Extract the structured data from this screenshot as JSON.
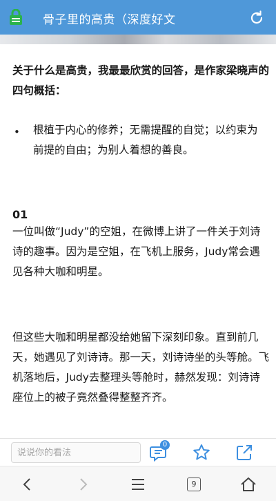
{
  "titlebar": {
    "title": "骨子里的高贵（深度好文"
  },
  "article": {
    "intro": "关于什么是高贵，我最最欣赏的回答，是作家梁晓声的四句概括：",
    "bullet_marker": "•",
    "bullet_text": "根植于内心的修养；无需提醒的自觉；以约束为前提的自由；为别人着想的善良。",
    "heading": "01",
    "p1": "一位叫做“Judy”的空姐，在微博上讲了一件关于刘诗诗的趣事。因为是空姐，在飞机上服务，Judy常会遇见各种大咖和明星。",
    "p2": "但这些大咖和明星都没给她留下深刻印象。直到前几天，她遇见了刘诗诗。那一天，刘诗诗坐的头等舱。飞机落地后，Judy去整理头等舱时，赫然发现：刘诗诗座位上的被子竟然叠得整整齐齐。"
  },
  "comment_bar": {
    "placeholder": "说说你的看法",
    "comment_count": "0"
  },
  "navbar": {
    "tab_count": "9"
  },
  "colors": {
    "titlebar_bg": "#4f98d9",
    "badge": "#3d8fe0",
    "lock": "#2bb24c"
  }
}
